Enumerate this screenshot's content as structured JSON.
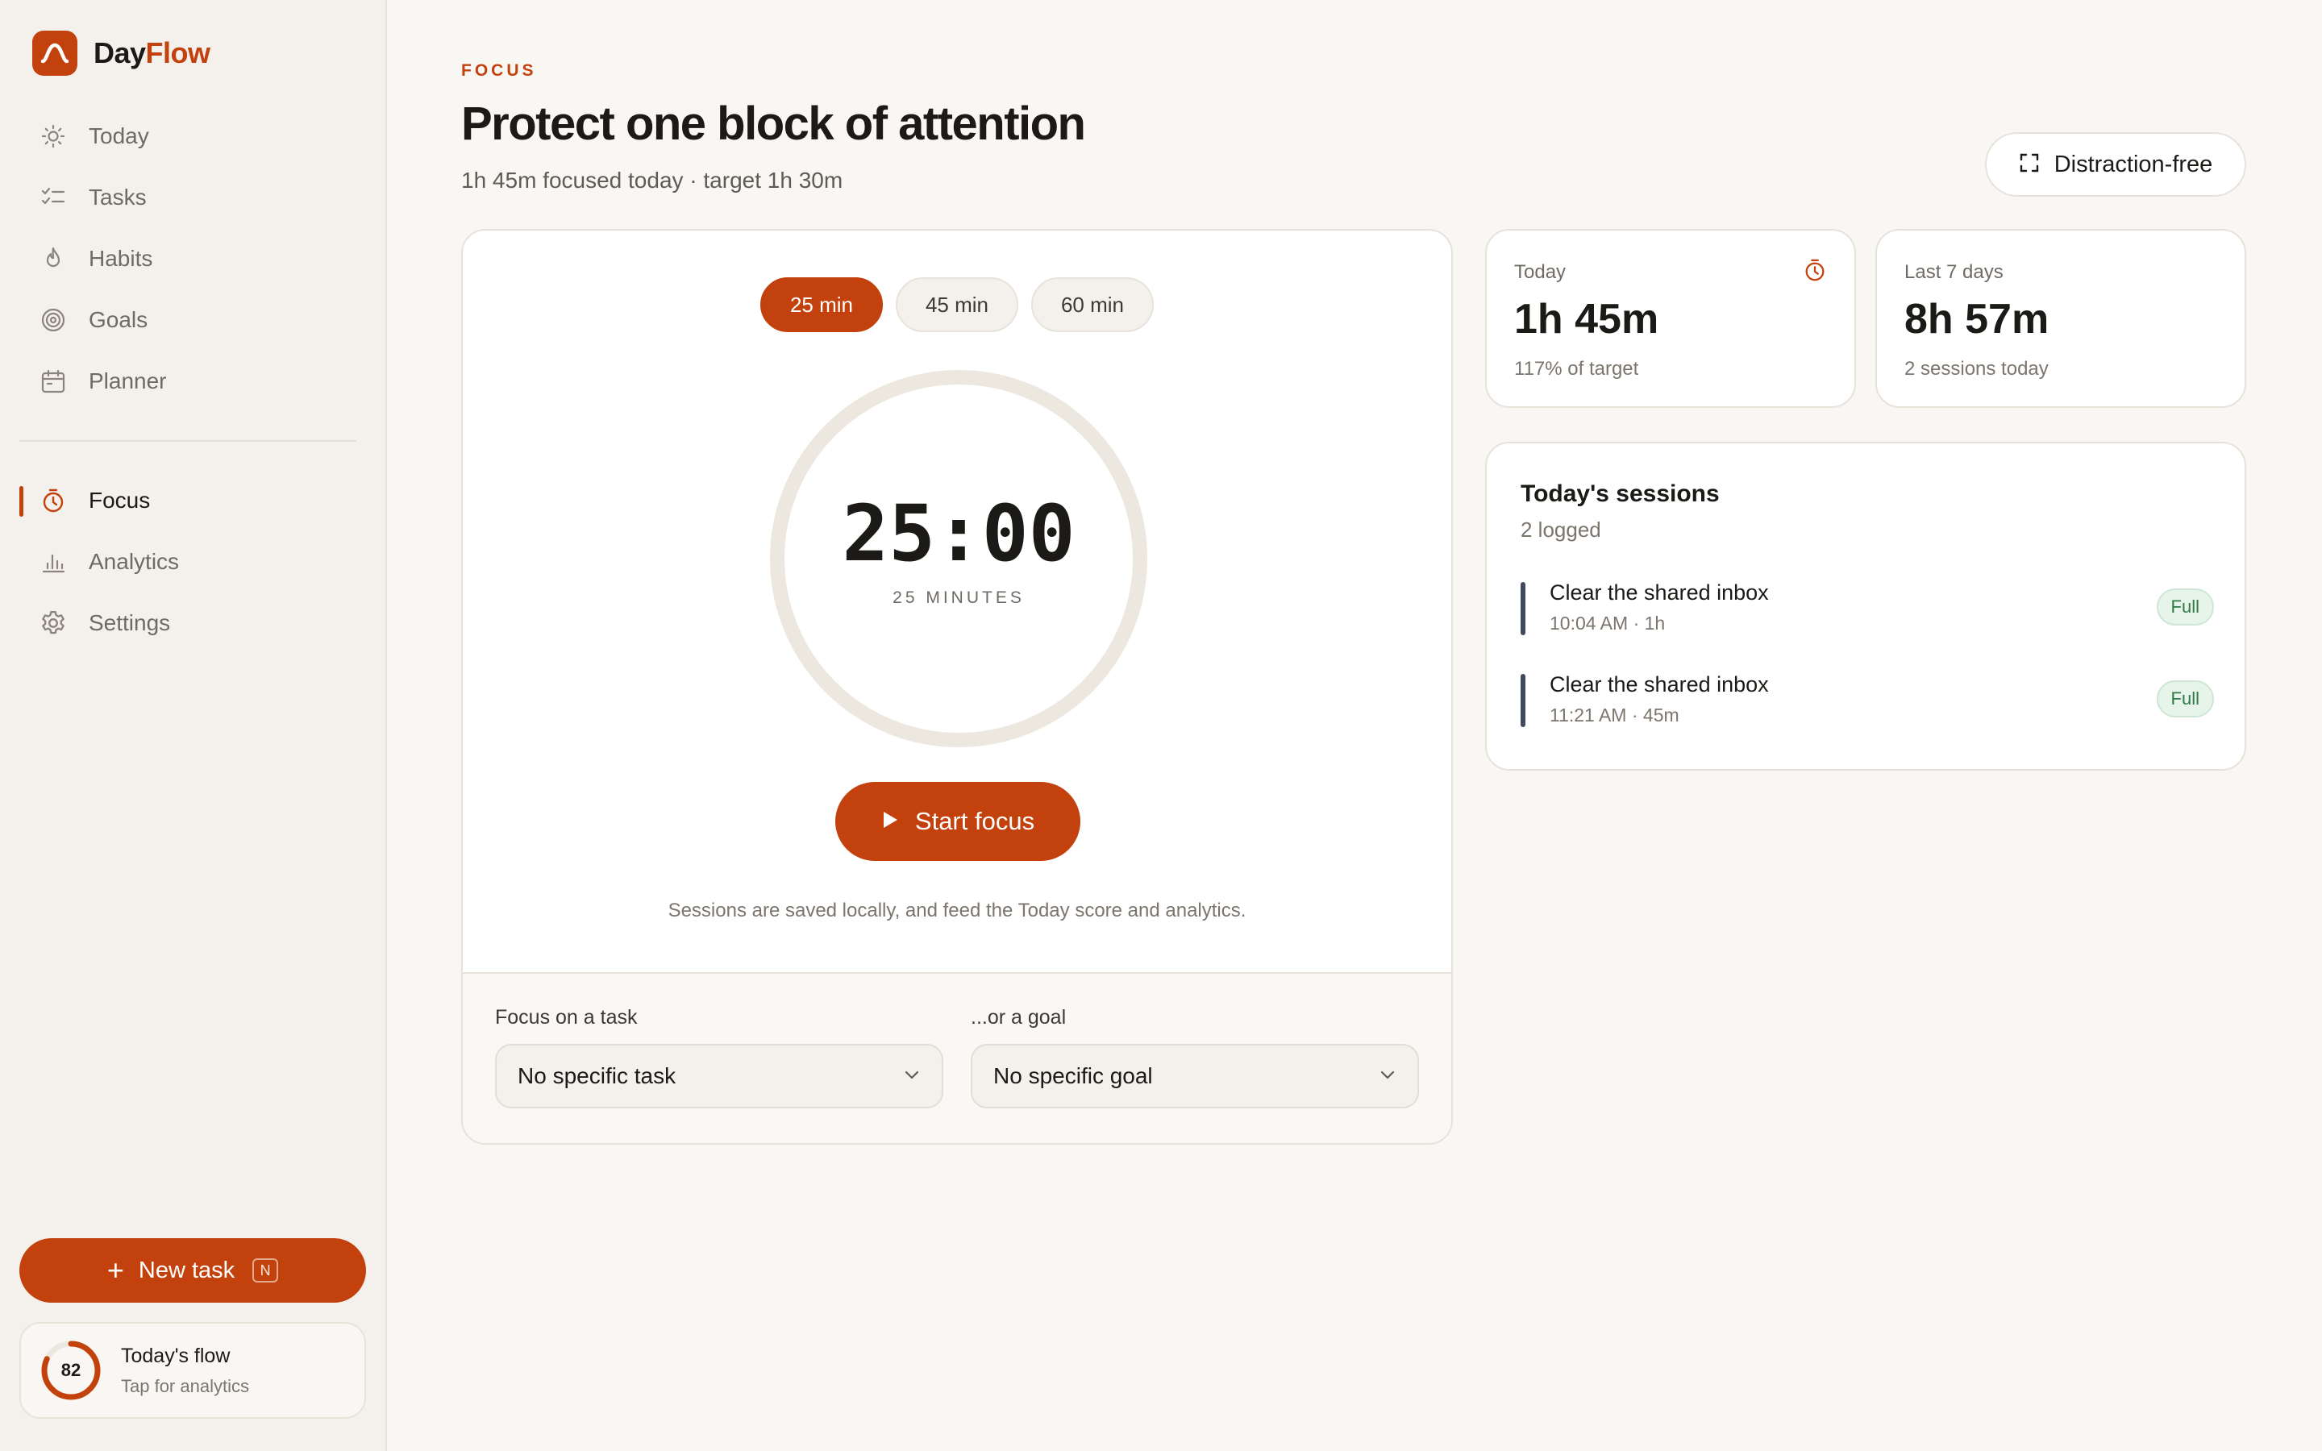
{
  "app": {
    "name_part1": "Day",
    "name_part2": "Flow",
    "accent_color": "#c2410c",
    "logo_icon": "arch-icon"
  },
  "sidebar": {
    "primary_items": [
      {
        "label": "Today",
        "icon": "sun-icon"
      },
      {
        "label": "Tasks",
        "icon": "checklist-icon"
      },
      {
        "label": "Habits",
        "icon": "flame-icon"
      },
      {
        "label": "Goals",
        "icon": "target-icon"
      },
      {
        "label": "Planner",
        "icon": "calendar-icon"
      }
    ],
    "secondary_items": [
      {
        "label": "Focus",
        "icon": "timer-icon",
        "active": true
      },
      {
        "label": "Analytics",
        "icon": "bar-chart-icon"
      },
      {
        "label": "Settings",
        "icon": "gear-icon"
      }
    ],
    "new_task": {
      "label": "New task",
      "shortcut": "N"
    },
    "flow": {
      "score": "82",
      "score_fraction": 0.82,
      "title": "Today's flow",
      "subtitle": "Tap for analytics"
    }
  },
  "header": {
    "eyebrow": "FOCUS",
    "title": "Protect one block of attention",
    "subtitle": "1h 45m focused today · target 1h 30m",
    "distraction_free_label": "Distraction-free"
  },
  "focus": {
    "durations": [
      {
        "label": "25 min",
        "active": true
      },
      {
        "label": "45 min",
        "active": false
      },
      {
        "label": "60 min",
        "active": false
      }
    ],
    "timer_value": "25:00",
    "timer_caption": "25 MINUTES",
    "start_label": "Start focus",
    "note": "Sessions are saved locally, and feed the Today score and analytics.",
    "task_field": {
      "label": "Focus on a task",
      "value": "No specific task"
    },
    "goal_field": {
      "label": "...or a goal",
      "value": "No specific goal"
    }
  },
  "stats": [
    {
      "label": "Today",
      "value": "1h 45m",
      "sub": "117% of target",
      "icon": "timer-icon"
    },
    {
      "label": "Last 7 days",
      "value": "8h 57m",
      "sub": "2 sessions today"
    }
  ],
  "sessions": {
    "title": "Today's sessions",
    "subtitle": "2 logged",
    "items": [
      {
        "name": "Clear the shared inbox",
        "meta": "10:04 AM · 1h",
        "badge": "Full"
      },
      {
        "name": "Clear the shared inbox",
        "meta": "11:21 AM · 45m",
        "badge": "Full"
      }
    ]
  }
}
